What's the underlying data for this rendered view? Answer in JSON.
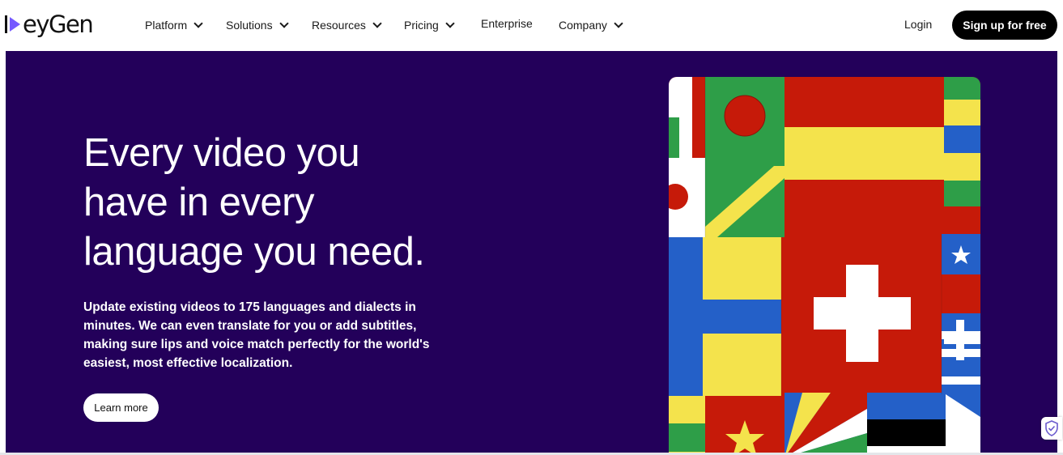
{
  "brand": {
    "name": "HeyGen",
    "logo_text": "eyGen",
    "accent": "#7559ff"
  },
  "nav": {
    "items": [
      {
        "label": "Platform",
        "has_dropdown": true
      },
      {
        "label": "Solutions",
        "has_dropdown": true
      },
      {
        "label": "Resources",
        "has_dropdown": true
      },
      {
        "label": "Pricing",
        "has_dropdown": true
      },
      {
        "label": "Enterprise",
        "has_dropdown": false
      },
      {
        "label": "Company",
        "has_dropdown": true
      }
    ],
    "login_label": "Login",
    "signup_label": "Sign up for free"
  },
  "hero": {
    "headline_lines": [
      "Every video you",
      "have in every",
      "language you need."
    ],
    "subtext": "Update existing videos to 175 languages and dialects in minutes. We can even translate for you or add subtitles, making sure lips and voice match perfectly for the world's easiest, most effective localization.",
    "cta_label": "Learn more",
    "background_color": "#23005a"
  },
  "icons": {
    "nav_chevron": "chevron-down-icon",
    "privacy_badge": "shield-check-icon"
  }
}
